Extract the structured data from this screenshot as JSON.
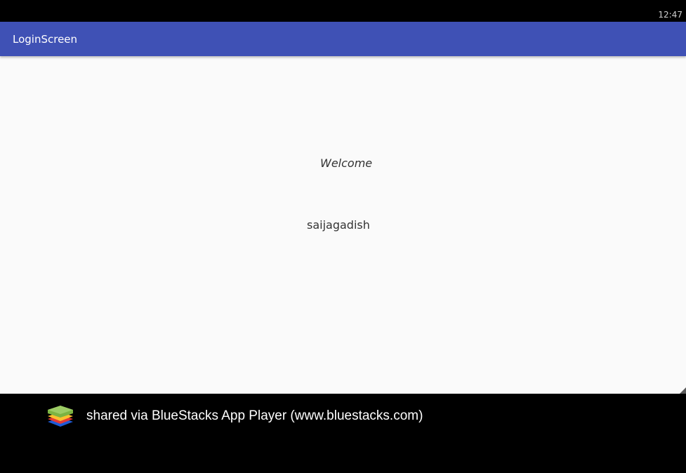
{
  "status_bar": {
    "time": "12:47"
  },
  "app_bar": {
    "title": "LoginScreen",
    "color": "#3f51b5"
  },
  "main": {
    "welcome_text": "Welcome",
    "username": "saijagadish"
  },
  "footer": {
    "logo_icon": "bluestacks-logo-icon",
    "text": "shared via BlueStacks App Player (www.bluestacks.com)"
  }
}
